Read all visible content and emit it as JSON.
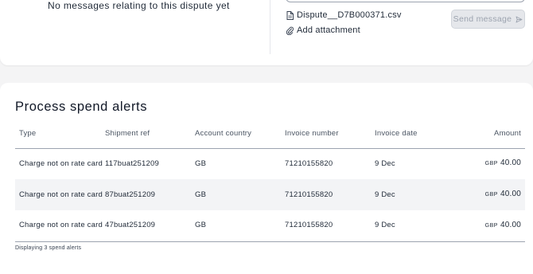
{
  "conversation": {
    "empty_message": "No messages relating to this dispute yet"
  },
  "composer": {
    "attached_file": "Dispute__D7B000371.csv",
    "add_attachment_label": "Add attachment",
    "send_label": "Send message"
  },
  "spend_alerts": {
    "title": "Process spend alerts",
    "columns": [
      "Type",
      "Shipment ref",
      "Account country",
      "Invoice number",
      "Invoice date",
      "Amount"
    ],
    "rows": [
      {
        "type": "Charge not on rate card",
        "shipment_ref": "117buat251209",
        "account_country": "GB",
        "invoice_number": "71210155820",
        "invoice_date": "9 Dec",
        "currency": "GBP",
        "amount": "40.00"
      },
      {
        "type": "Charge not on rate card",
        "shipment_ref": "87buat251209",
        "account_country": "GB",
        "invoice_number": "71210155820",
        "invoice_date": "9 Dec",
        "currency": "GBP",
        "amount": "40.00"
      },
      {
        "type": "Charge not on rate card",
        "shipment_ref": "47buat251209",
        "account_country": "GB",
        "invoice_number": "71210155820",
        "invoice_date": "9 Dec",
        "currency": "GBP",
        "amount": "40.00"
      }
    ],
    "footer": "Displaying 3 spend alerts"
  },
  "icons": {
    "file": "file-icon",
    "attachment": "paperclip-icon",
    "send": "send-icon"
  },
  "colors": {
    "page_bg": "#f4f4f5",
    "card_bg": "#ffffff",
    "row_alt": "#f3f4f6",
    "disabled_button": "#e5e7eb",
    "disabled_text": "#9ca3af"
  }
}
